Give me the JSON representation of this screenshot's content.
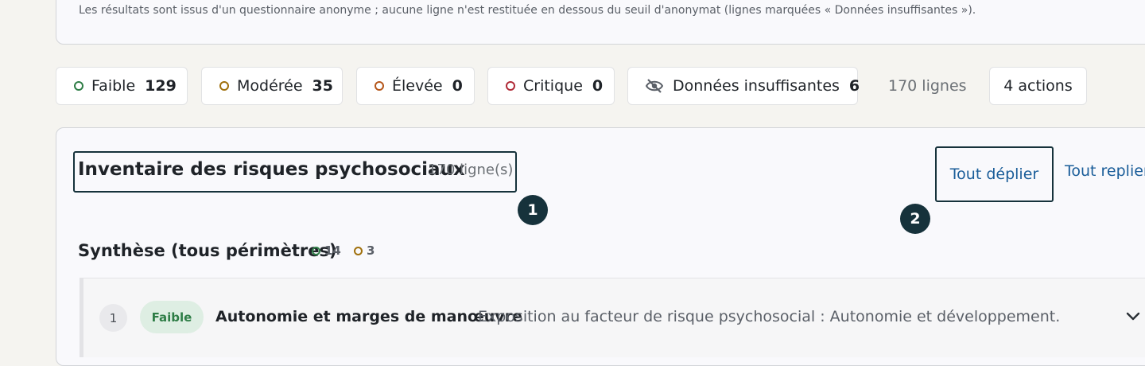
{
  "notice": "Les résultats sont issus d'un questionnaire anonyme ; aucune ligne n'est restituée en dessous du seuil d'anonymat (lignes marquées « Données insuffisantes »).",
  "filters": [
    {
      "label": "Faible",
      "count": "129",
      "color": "#2e7d46"
    },
    {
      "label": "Modérée",
      "count": "35",
      "color": "#a0700c"
    },
    {
      "label": "Élevée",
      "count": "0",
      "color": "#b5561a"
    },
    {
      "label": "Critique",
      "count": "0",
      "color": "#b02a37"
    },
    {
      "label": "Données insuffisantes",
      "count": "6",
      "icon": "eye-slash-icon"
    }
  ],
  "total_lines": "170 lignes",
  "actions_label": "4 actions",
  "inventory": {
    "title": "Inventaire des risques psychosociaux",
    "count": "170 ligne(s)",
    "expand_all": "Tout déplier",
    "collapse_all": "Tout replier",
    "callouts": [
      "1",
      "2"
    ]
  },
  "summary": {
    "title": "Synthèse (tous périmètres)",
    "counts": [
      {
        "value": "14",
        "color": "#2e7d46"
      },
      {
        "value": "3",
        "color": "#a0700c"
      }
    ]
  },
  "rows": [
    {
      "number": "1",
      "level": "Faible",
      "title": "Autonomie et marges de manœuvre",
      "description": "Exposition au facteur de risque psychosocial : Autonomie et développement."
    }
  ]
}
